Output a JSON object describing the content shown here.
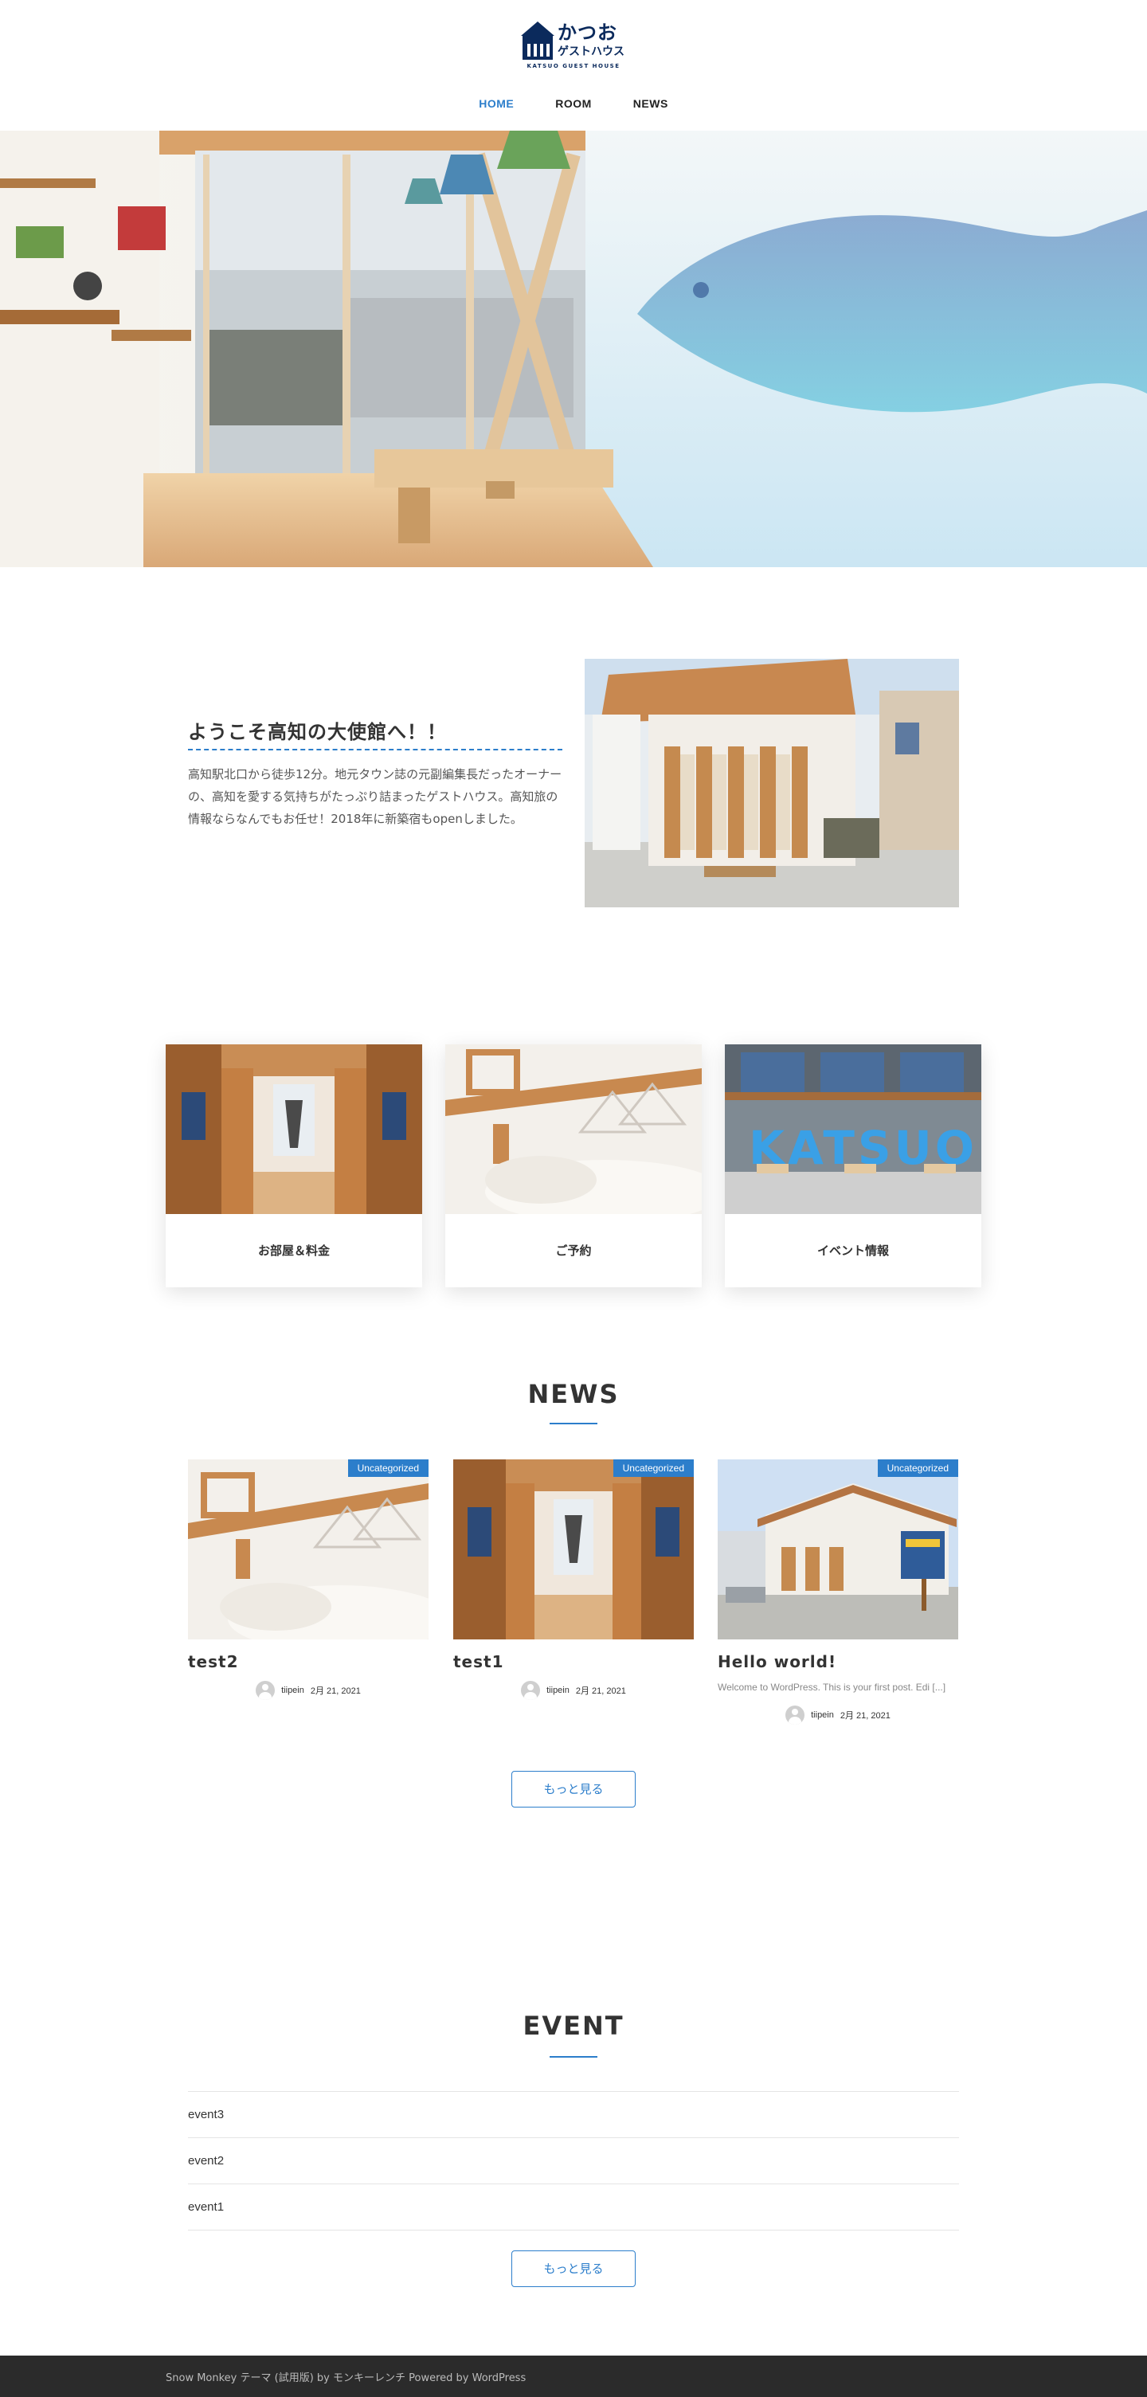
{
  "header": {
    "logo_title": "かつお",
    "logo_sub": "ゲストハウス",
    "logo_en": "KATSUO GUEST HOUSE",
    "nav": [
      {
        "label": "HOME",
        "active": true
      },
      {
        "label": "ROOM",
        "active": false
      },
      {
        "label": "NEWS",
        "active": false
      }
    ]
  },
  "hero": {
    "icon": "living-room-photo"
  },
  "intro": {
    "title": "ようこそ高知の大使館へ！！",
    "text": "高知駅北口から徒歩12分。地元タウン誌の元副編集長だったオーナーの、高知を愛する気持ちがたっぷり詰まったゲストハウス。高知旅の情報ならなんでもお任せ！2018年に新築宿もopenしました。"
  },
  "cards": [
    {
      "label": "お部屋＆料金"
    },
    {
      "label": "ご予約"
    },
    {
      "label": "イベント情報"
    }
  ],
  "news": {
    "heading": "NEWS",
    "items": [
      {
        "badge": "Uncategorized",
        "title": "test2",
        "excerpt": "",
        "author": "tiipein",
        "date": "2月 21, 2021"
      },
      {
        "badge": "Uncategorized",
        "title": "test1",
        "excerpt": "",
        "author": "tiipein",
        "date": "2月 21, 2021"
      },
      {
        "badge": "Uncategorized",
        "title": "Hello world!",
        "excerpt": "Welcome to WordPress. This is your first post. Edi [...]",
        "author": "tiipein",
        "date": "2月 21, 2021"
      }
    ],
    "more_label": "もっと見る"
  },
  "event": {
    "heading": "EVENT",
    "items": [
      "event3",
      "event2",
      "event1"
    ],
    "more_label": "もっと見る"
  },
  "footer": {
    "text": "Snow Monkey テーマ (試用版) by モンキーレンチ Powered by WordPress"
  },
  "colors": {
    "accent": "#2c7ecb",
    "navy": "#0b2a5c",
    "footer_bg": "#2b2b2b"
  }
}
